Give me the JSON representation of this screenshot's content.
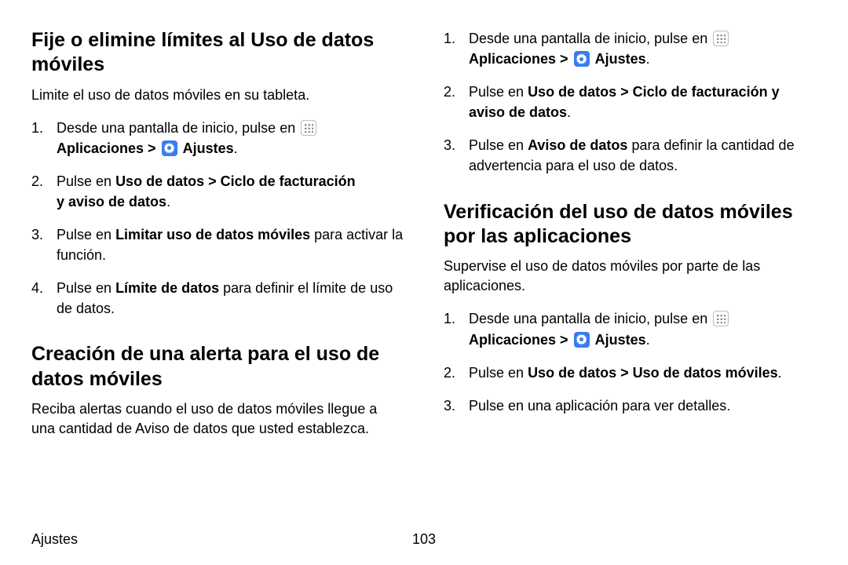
{
  "left": {
    "h1": "Fije o elimine límites al Uso de datos móviles",
    "intro1": "Limite el uso de datos móviles en su tableta.",
    "s1_1a": "Desde una pantalla de inicio, pulse en ",
    "s1_1b": "Aplicaciones",
    "s1_1c": " > ",
    "s1_1d": "Ajustes",
    "s1_1e": ".",
    "s1_2a": "Pulse en ",
    "s1_2b": "Uso de datos",
    "s1_2c": " > ",
    "s1_2d": "Ciclo de facturación y aviso de datos",
    "s1_2e": ".",
    "s1_3a": "Pulse en ",
    "s1_3b": "Limitar uso de datos móviles",
    "s1_3c": " para activar la función.",
    "s1_4a": "Pulse en ",
    "s1_4b": "Límite de datos",
    "s1_4c": " para definir el límite de uso de datos.",
    "h2": "Creación de una alerta para el uso de datos móviles",
    "intro2": "Reciba alertas cuando el uso de datos móviles llegue a una cantidad de Aviso de datos que usted establezca."
  },
  "right": {
    "r1_1a": "Desde una pantalla de inicio, pulse en ",
    "r1_1b": "Aplicaciones",
    "r1_1c": " > ",
    "r1_1d": "Ajustes",
    "r1_1e": ".",
    "r1_2a": "Pulse en ",
    "r1_2b": "Uso de datos",
    "r1_2c": " > ",
    "r1_2d": "Ciclo de facturación y aviso de datos",
    "r1_2e": ".",
    "r1_3a": "Pulse en ",
    "r1_3b": "Aviso de datos",
    "r1_3c": " para definir la cantidad de advertencia para el uso de datos.",
    "h3": "Verificación del uso de datos móviles por las aplicaciones",
    "intro3": "Supervise el uso de datos móviles por parte de las aplicaciones.",
    "r2_1a": "Desde una pantalla de inicio, pulse en ",
    "r2_1b": "Aplicaciones",
    "r2_1c": " > ",
    "r2_1d": "Ajustes",
    "r2_1e": ".",
    "r2_2a": "Pulse en ",
    "r2_2b": "Uso de datos",
    "r2_2c": " > ",
    "r2_2d": "Uso de datos móviles",
    "r2_2e": ".",
    "r2_3": "Pulse en una aplicación para ver detalles."
  },
  "footer": {
    "section": "Ajustes",
    "page": "103"
  }
}
